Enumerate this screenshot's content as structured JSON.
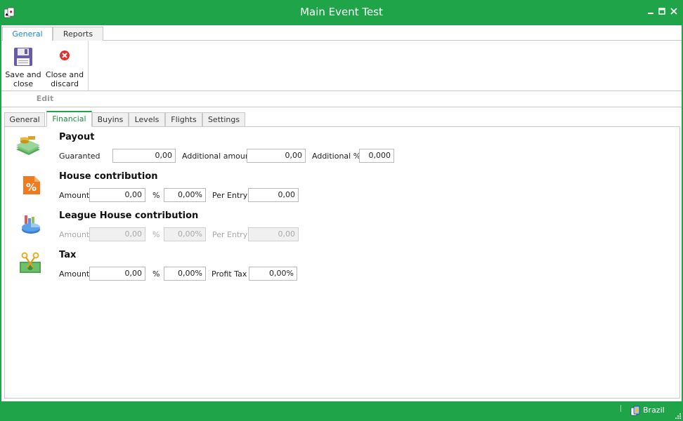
{
  "window": {
    "title": "Main Event Test"
  },
  "ribbon": {
    "tabs": [
      "General",
      "Reports"
    ],
    "buttons": {
      "save": "Save and\nclose",
      "close": "Close and\ndiscard"
    },
    "group_label": "Edit"
  },
  "tabs": [
    "General",
    "Financial",
    "Buyins",
    "Levels",
    "Flights",
    "Settings"
  ],
  "payout": {
    "title": "Payout",
    "guaranted_label": "Guaranted",
    "guaranted_value": "0,00",
    "additional_amount_label": "Additional amount",
    "additional_amount_value": "0,00",
    "additional_pct_label": "Additional %",
    "additional_pct_value": "0,000"
  },
  "house": {
    "title": "House contribution",
    "amount_label": "Amount",
    "amount_value": "0,00",
    "pct_label": "%",
    "pct_value": "0,00%",
    "per_entry_label": "Per Entry",
    "per_entry_value": "0,00"
  },
  "league": {
    "title": "League House contribution",
    "amount_label": "Amount",
    "amount_value": "0,00",
    "pct_label": "%",
    "pct_value": "0,00%",
    "per_entry_label": "Per Entry",
    "per_entry_value": "0,00"
  },
  "tax": {
    "title": "Tax",
    "amount_label": "Amount",
    "amount_value": "0,00",
    "pct_label": "%",
    "pct_value": "0,00%",
    "profit_tax_label": "Profit Tax",
    "profit_tax_value": "0,00%"
  },
  "status": {
    "region": "Brazil"
  }
}
